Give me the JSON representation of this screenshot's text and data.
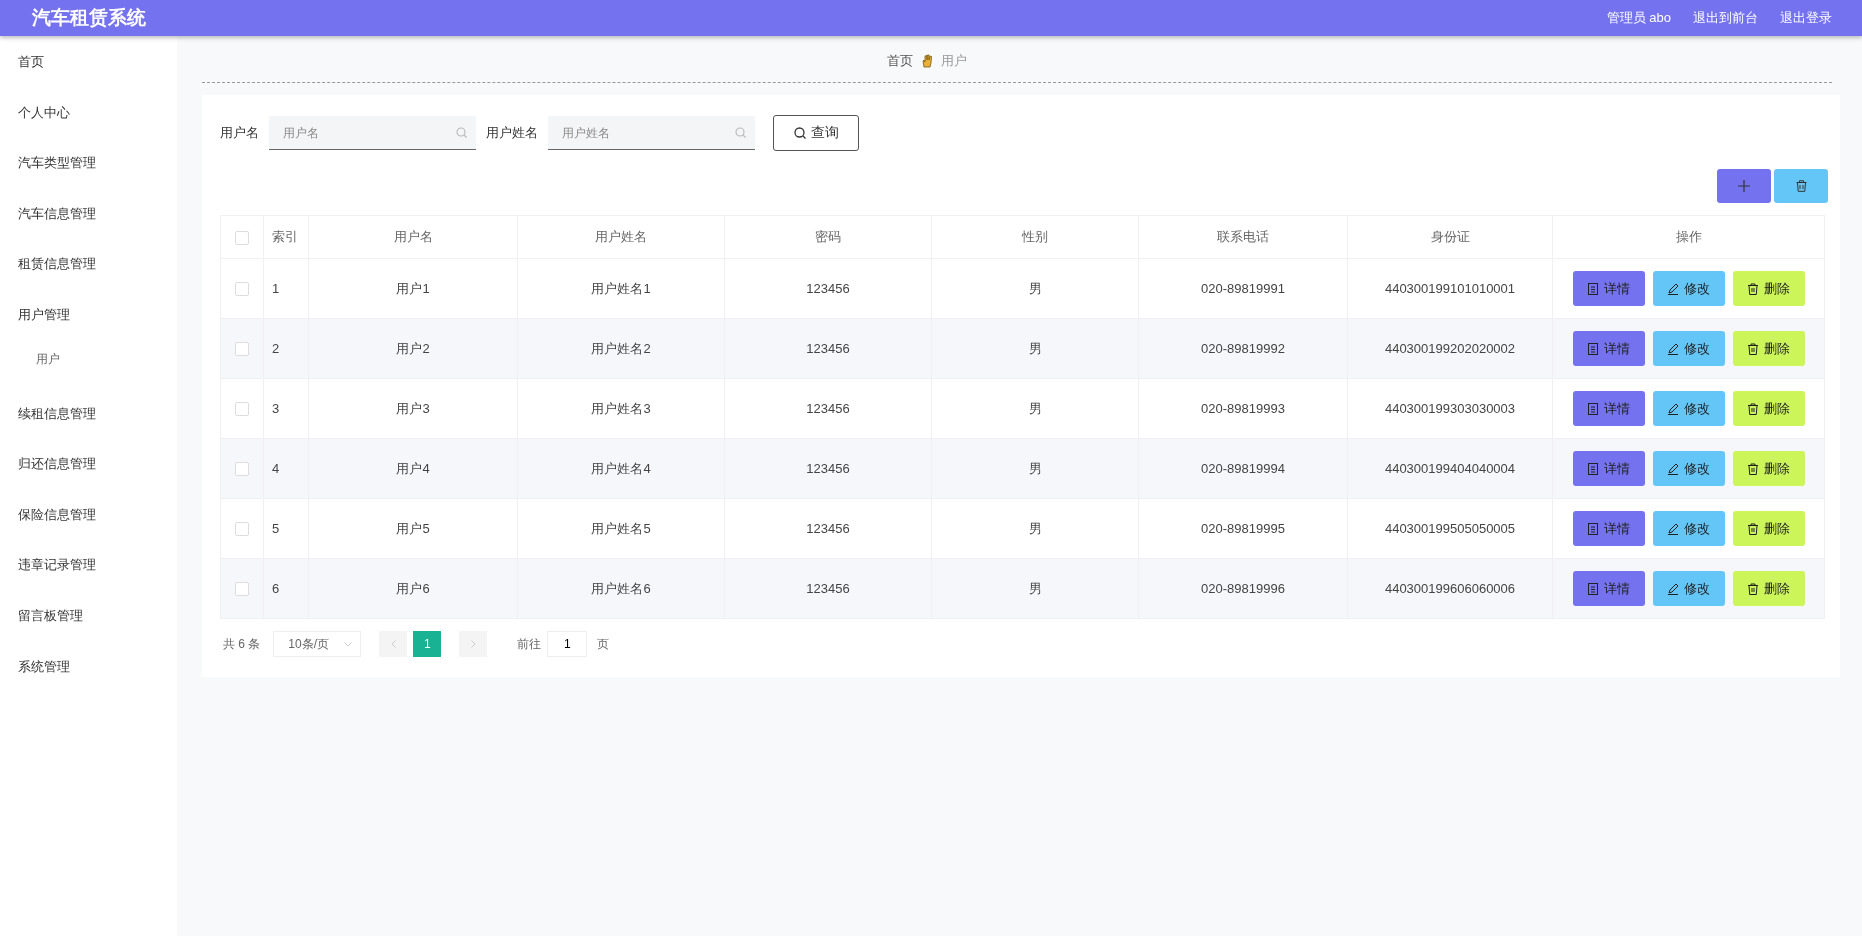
{
  "header": {
    "title": "汽车租赁系统",
    "user": "管理员 abo",
    "links": [
      "退出到前台",
      "退出登录"
    ]
  },
  "sidebar": {
    "items": [
      {
        "label": "首页"
      },
      {
        "label": "个人中心"
      },
      {
        "label": "汽车类型管理"
      },
      {
        "label": "汽车信息管理"
      },
      {
        "label": "租赁信息管理"
      },
      {
        "label": "用户管理",
        "children": [
          {
            "label": "用户"
          }
        ]
      },
      {
        "label": "续租信息管理"
      },
      {
        "label": "归还信息管理"
      },
      {
        "label": "保险信息管理"
      },
      {
        "label": "违章记录管理"
      },
      {
        "label": "留言板管理"
      },
      {
        "label": "系统管理"
      }
    ]
  },
  "breadcrumb": [
    "首页",
    "用户"
  ],
  "search": {
    "fields": [
      {
        "label": "用户名",
        "placeholder": "用户名"
      },
      {
        "label": "用户姓名",
        "placeholder": "用户姓名"
      }
    ],
    "button": "查询"
  },
  "table": {
    "all_checked": false,
    "columns": [
      "索引",
      "用户名",
      "用户姓名",
      "密码",
      "性别",
      "联系电话",
      "身份证",
      "操作"
    ],
    "rows": [
      {
        "checked": false,
        "cells": [
          "1",
          "用户1",
          "用户姓名1",
          "123456",
          "男",
          "020-89819991",
          "440300199101010001"
        ],
        "actions": [
          {
            "kind": "detail",
            "label": "详情"
          },
          {
            "kind": "edit",
            "label": "修改"
          },
          {
            "kind": "delete",
            "label": "删除"
          }
        ]
      },
      {
        "checked": false,
        "cells": [
          "2",
          "用户2",
          "用户姓名2",
          "123456",
          "男",
          "020-89819992",
          "440300199202020002"
        ],
        "actions": [
          {
            "kind": "detail",
            "label": "详情"
          },
          {
            "kind": "edit",
            "label": "修改"
          },
          {
            "kind": "delete",
            "label": "删除"
          }
        ]
      },
      {
        "checked": false,
        "cells": [
          "3",
          "用户3",
          "用户姓名3",
          "123456",
          "男",
          "020-89819993",
          "440300199303030003"
        ],
        "actions": [
          {
            "kind": "detail",
            "label": "详情"
          },
          {
            "kind": "edit",
            "label": "修改"
          },
          {
            "kind": "delete",
            "label": "删除"
          }
        ]
      },
      {
        "checked": false,
        "cells": [
          "4",
          "用户4",
          "用户姓名4",
          "123456",
          "男",
          "020-89819994",
          "440300199404040004"
        ],
        "actions": [
          {
            "kind": "detail",
            "label": "详情"
          },
          {
            "kind": "edit",
            "label": "修改"
          },
          {
            "kind": "delete",
            "label": "删除"
          }
        ]
      },
      {
        "checked": false,
        "cells": [
          "5",
          "用户5",
          "用户姓名5",
          "123456",
          "男",
          "020-89819995",
          "440300199505050005"
        ],
        "actions": [
          {
            "kind": "detail",
            "label": "详情"
          },
          {
            "kind": "edit",
            "label": "修改"
          },
          {
            "kind": "delete",
            "label": "删除"
          }
        ]
      },
      {
        "checked": false,
        "cells": [
          "6",
          "用户6",
          "用户姓名6",
          "123456",
          "男",
          "020-89819996",
          "440300199606060006"
        ],
        "actions": [
          {
            "kind": "detail",
            "label": "详情"
          },
          {
            "kind": "edit",
            "label": "修改"
          },
          {
            "kind": "delete",
            "label": "删除"
          }
        ]
      }
    ]
  },
  "pagination": {
    "total": "共 6 条",
    "page_size": "10条/页",
    "pages": [
      {
        "label": "1",
        "selected": true
      }
    ],
    "goto_label": "前往",
    "goto_value": "1",
    "goto_suffix": "页"
  }
}
